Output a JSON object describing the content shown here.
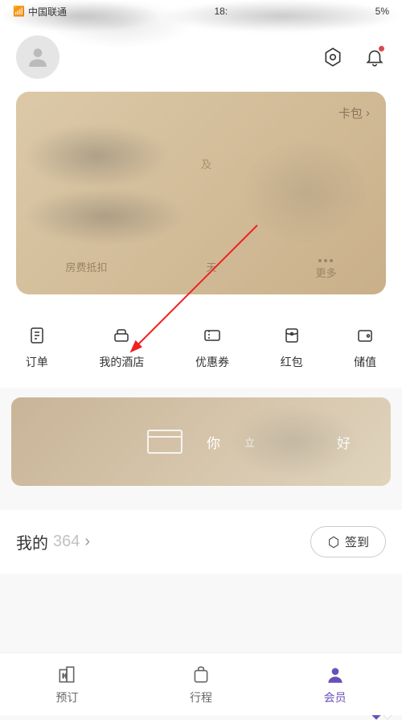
{
  "status": {
    "carrier": "中国联通",
    "time": "18:",
    "battery": "5%"
  },
  "header": {
    "settings_icon": "settings",
    "bell_icon": "notifications"
  },
  "card": {
    "wallet_label": "卡包",
    "item1": "房费抵扣",
    "item2": "天",
    "more_label": "更多",
    "and_char": "及"
  },
  "quick": [
    {
      "label": "订单"
    },
    {
      "label": "我的酒店"
    },
    {
      "label": "优惠券"
    },
    {
      "label": "红包"
    },
    {
      "label": "储值"
    }
  ],
  "banner": {
    "text1": "你",
    "text2": "立",
    "text3": "好"
  },
  "points": {
    "title_prefix": "我的",
    "title_suffix": "364",
    "signin_label": "签到"
  },
  "tabs": [
    {
      "label": "预订"
    },
    {
      "label": "行程"
    },
    {
      "label": "会员"
    }
  ]
}
